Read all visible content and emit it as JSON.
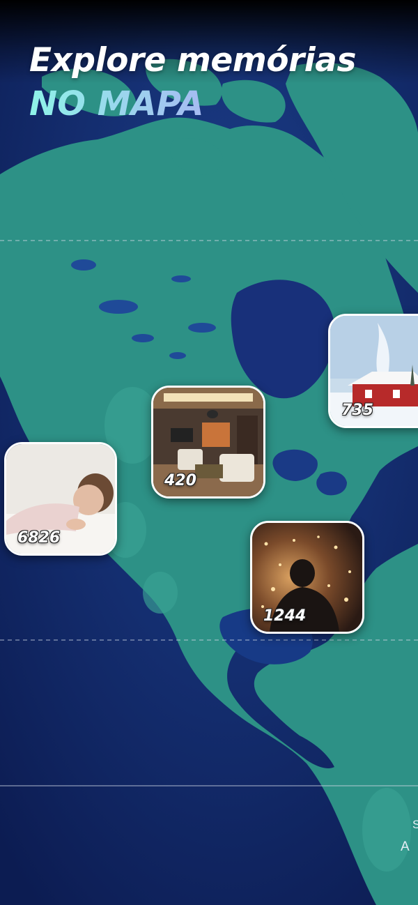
{
  "header": {
    "title": "Explore memórias",
    "subtitle": "NO MAPA"
  },
  "map": {
    "land_color": "#2b8f86",
    "ocean_color": "#0f2a6b",
    "edge_labels": [
      "A",
      "S"
    ]
  },
  "pins": [
    {
      "id": "snow-house",
      "count": "735",
      "icon": "snow-house-photo"
    },
    {
      "id": "living-room",
      "count": "420",
      "icon": "living-room-photo"
    },
    {
      "id": "baby",
      "count": "6826",
      "icon": "baby-photo"
    },
    {
      "id": "fireworks",
      "count": "1244",
      "icon": "fireworks-child-photo"
    }
  ],
  "colors": {
    "subtitle_gradient": [
      "#8ef3e8",
      "#a7b9f2",
      "#d8a7f4"
    ],
    "pin_border": "#ffffff"
  }
}
